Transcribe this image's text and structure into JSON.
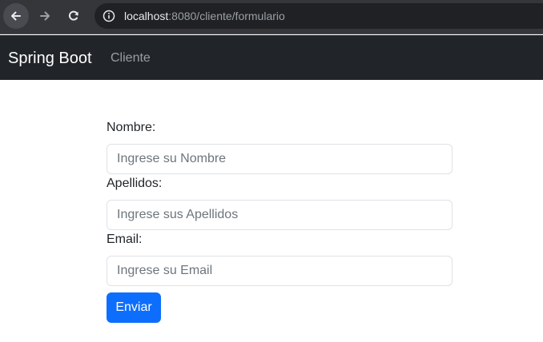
{
  "browser": {
    "url_host": "localhost",
    "url_path": ":8080/cliente/formulario"
  },
  "navbar": {
    "brand": "Spring Boot",
    "links": [
      {
        "label": "Cliente"
      }
    ]
  },
  "form": {
    "fields": [
      {
        "label": "Nombre:",
        "placeholder": "Ingrese su Nombre",
        "value": ""
      },
      {
        "label": "Apellidos:",
        "placeholder": "Ingrese sus Apellidos",
        "value": ""
      },
      {
        "label": "Email:",
        "placeholder": "Ingrese su Email",
        "value": ""
      }
    ],
    "submit_label": "Enviar"
  },
  "colors": {
    "navbar_bg": "#212529",
    "primary": "#0d6efd",
    "browser_bg": "#35363a"
  },
  "icons": {
    "back": "arrow-left-icon",
    "forward": "arrow-right-icon",
    "reload": "reload-icon",
    "site_info": "info-icon"
  }
}
